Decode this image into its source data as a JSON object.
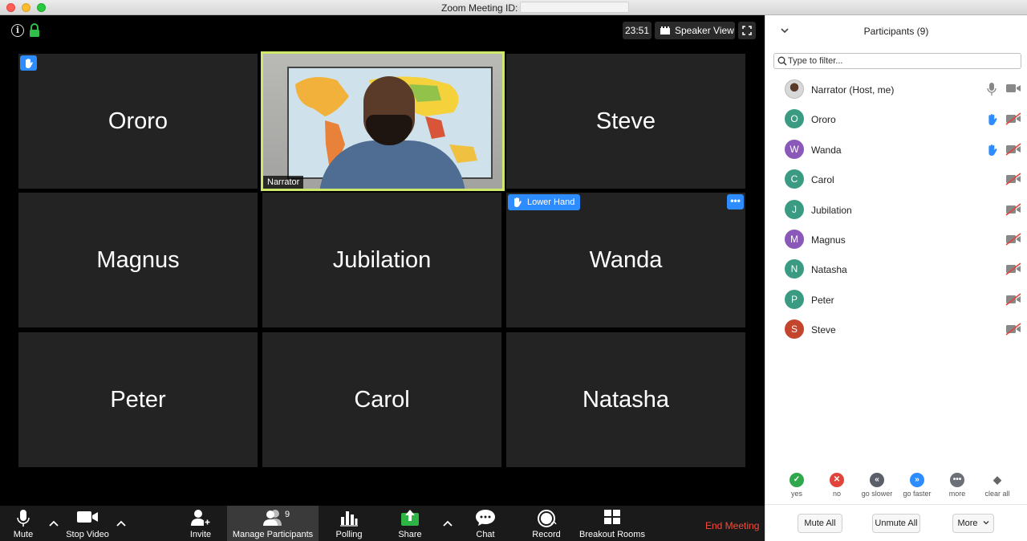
{
  "window": {
    "title": "Zoom Meeting ID:"
  },
  "top_bar": {
    "timer": "23:51",
    "view_label": "Speaker View"
  },
  "tiles": [
    {
      "name": "Ororo"
    },
    {
      "name": "Narrator"
    },
    {
      "name": "Steve"
    },
    {
      "name": "Magnus"
    },
    {
      "name": "Jubilation"
    },
    {
      "name": "Wanda"
    },
    {
      "name": "Peter"
    },
    {
      "name": "Carol"
    },
    {
      "name": "Natasha"
    }
  ],
  "lower_hand_label": "Lower Hand",
  "more_label": "•••",
  "toolbar": {
    "mute": "Mute",
    "stop_video": "Stop Video",
    "invite": "Invite",
    "manage_participants": "Manage Participants",
    "participants_count": "9",
    "polling": "Polling",
    "share": "Share",
    "chat": "Chat",
    "record": "Record",
    "breakout_rooms": "Breakout Rooms",
    "end_meeting": "End Meeting"
  },
  "panel": {
    "title": "Participants (9)",
    "filter_placeholder": "Type to filter...",
    "participants": [
      {
        "name": "Narrator (Host, me)",
        "initial": "",
        "color": "",
        "hand": false,
        "host": true
      },
      {
        "name": "Ororo",
        "initial": "O",
        "color": "#3a9b82",
        "hand": true
      },
      {
        "name": "Wanda",
        "initial": "W",
        "color": "#8a58b8",
        "hand": true
      },
      {
        "name": "Carol",
        "initial": "C",
        "color": "#3a9b82",
        "hand": false
      },
      {
        "name": "Jubilation",
        "initial": "J",
        "color": "#3a9b82",
        "hand": false
      },
      {
        "name": "Magnus",
        "initial": "M",
        "color": "#8a58b8",
        "hand": false
      },
      {
        "name": "Natasha",
        "initial": "N",
        "color": "#3a9b82",
        "hand": false
      },
      {
        "name": "Peter",
        "initial": "P",
        "color": "#3a9b82",
        "hand": false
      },
      {
        "name": "Steve",
        "initial": "S",
        "color": "#c4452e",
        "hand": false
      }
    ],
    "reactions": [
      {
        "label": "yes",
        "glyph": "✓",
        "color": "#2ea84a"
      },
      {
        "label": "no",
        "glyph": "✕",
        "color": "#e0443a"
      },
      {
        "label": "go slower",
        "glyph": "«",
        "color": "#5a5f6a"
      },
      {
        "label": "go faster",
        "glyph": "»",
        "color": "#2d8cff"
      },
      {
        "label": "more",
        "glyph": "•••",
        "color": "#6b6f78"
      },
      {
        "label": "clear all",
        "glyph": "◆",
        "color": "transparent"
      }
    ],
    "mute_all": "Mute All",
    "unmute_all": "Unmute All",
    "more": "More"
  },
  "colors": {
    "accent": "#2d8cff",
    "end_meeting": "#f44b3c",
    "active_speaker_border": "#cfe86a"
  }
}
